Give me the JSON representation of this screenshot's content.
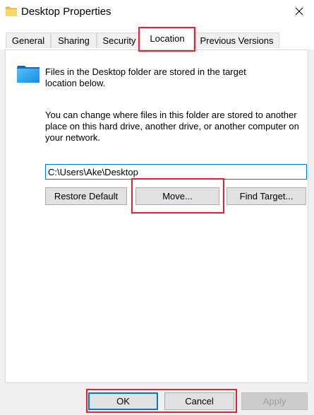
{
  "window": {
    "title": "Desktop Properties",
    "title_icon": "folder-icon",
    "close_icon": "close-icon"
  },
  "tabs": [
    {
      "label": "General",
      "active": false
    },
    {
      "label": "Sharing",
      "active": false
    },
    {
      "label": "Security",
      "active": false
    },
    {
      "label": "Location",
      "active": true
    },
    {
      "label": "Previous Versions",
      "active": false
    }
  ],
  "location": {
    "folder_icon": "desktop-folder-icon",
    "info_line1": "Files in the Desktop folder are stored in the target",
    "info_line2": "location below.",
    "desc_line1": "You can change where files in this folder are stored to another",
    "desc_line2": "place on this hard drive, another drive, or another computer on",
    "desc_line3": "your network.",
    "path_value": "C:\\Users\\Ake\\Desktop",
    "restore_default_label": "Restore Default",
    "move_label": "Move...",
    "find_target_label": "Find Target..."
  },
  "footer": {
    "ok_label": "OK",
    "cancel_label": "Cancel",
    "apply_label": "Apply"
  },
  "colors": {
    "highlight": "#e0232e",
    "accent": "#0078d7",
    "folder_blue": "#1e90ff",
    "folder_yellow": "#f0c040"
  }
}
